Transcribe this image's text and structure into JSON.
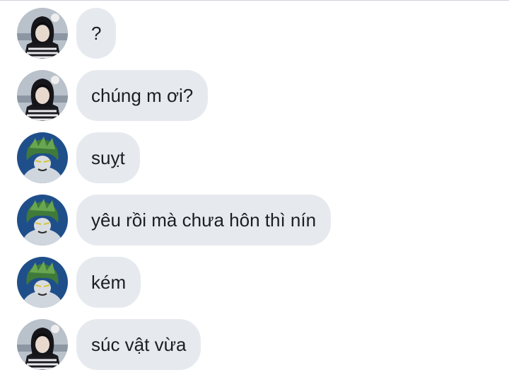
{
  "conversation": {
    "messages": [
      {
        "sender": "avatar-a",
        "text": "?"
      },
      {
        "sender": "avatar-a",
        "text": "chúng m ơi?"
      },
      {
        "sender": "avatar-b",
        "text": "suỵt"
      },
      {
        "sender": "avatar-b",
        "text": "yêu rồi mà chưa hôn thì nín"
      },
      {
        "sender": "avatar-b",
        "text": "kém"
      },
      {
        "sender": "avatar-a",
        "text": "súc vật vừa"
      }
    ]
  },
  "colors": {
    "bubble": "#e6eaef",
    "text": "#1c1e21",
    "avatar_a_bg": "#a9b2bd",
    "avatar_b_bg": "#1f4f8a"
  }
}
